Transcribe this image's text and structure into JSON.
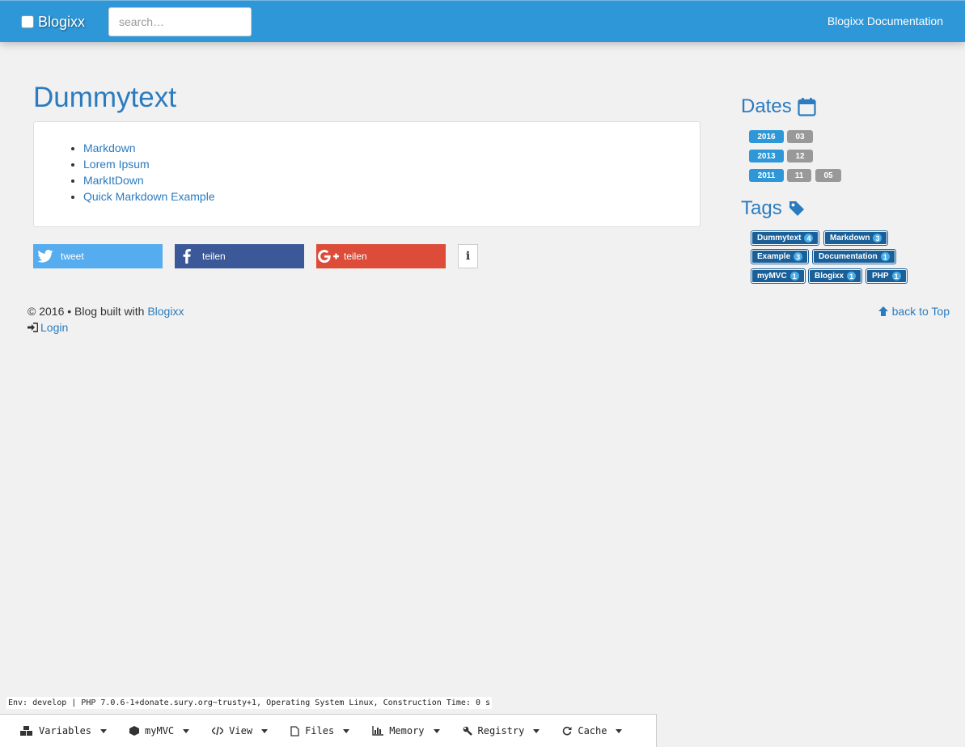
{
  "navbar": {
    "brand": "Blogixx",
    "search_placeholder": "search…",
    "doc_link": "Blogixx Documentation"
  },
  "main": {
    "title": "Dummytext",
    "links": [
      "Markdown",
      "Lorem Ipsum",
      "MarkItDown",
      "Quick Markdown Example"
    ],
    "share": {
      "tweet": "tweet",
      "facebook": "teilen",
      "google": "teilen"
    }
  },
  "sidebar": {
    "dates_heading": "Dates",
    "dates": [
      {
        "year": "2016",
        "subs": [
          "03"
        ]
      },
      {
        "year": "2013",
        "subs": [
          "12"
        ]
      },
      {
        "year": "2011",
        "subs": [
          "11",
          "05"
        ]
      }
    ],
    "tags_heading": "Tags",
    "tags": [
      {
        "name": "Dummytext",
        "count": "4"
      },
      {
        "name": "Markdown",
        "count": "3"
      },
      {
        "name": "Example",
        "count": "3"
      },
      {
        "name": "Documentation",
        "count": "1"
      },
      {
        "name": "myMVC",
        "count": "1"
      },
      {
        "name": "Blogixx",
        "count": "1"
      },
      {
        "name": "PHP",
        "count": "1"
      }
    ]
  },
  "footer": {
    "copyright": "© 2016 • Blog built with",
    "built_with_link": "Blogixx",
    "login": "Login",
    "back_to_top": "back to Top"
  },
  "debug": {
    "env_line": "Env: develop | PHP 7.0.6-1+donate.sury.org~trusty+1, Operating System Linux, Construction Time: 0 s",
    "tabs": [
      "Variables",
      "myMVC",
      "View",
      "Files",
      "Memory",
      "Registry",
      "Cache"
    ]
  }
}
